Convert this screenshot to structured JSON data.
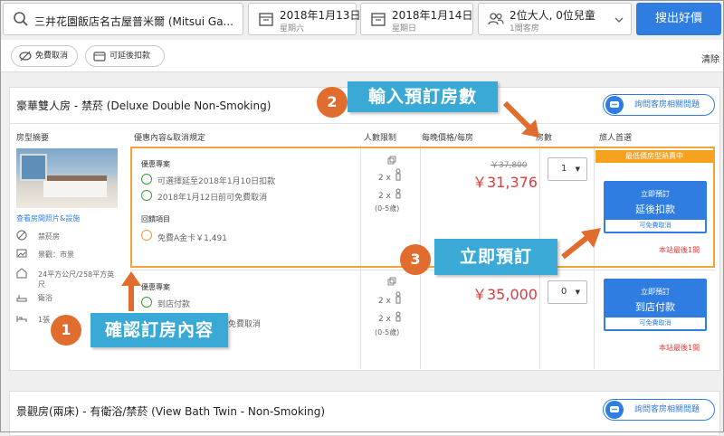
{
  "search": {
    "hotel": "三井花園飯店名古屋普米爾 (Mitsui Ga...",
    "checkin_date": "2018年1月13日",
    "checkin_day": "星期六",
    "checkout_date": "2018年1月14日",
    "checkout_day": "星期日",
    "guests": "2位大人, 0位兒童",
    "rooms": "1間客房",
    "button": "搜出好價"
  },
  "filters": {
    "free_cancel": "免費取消",
    "pay_later": "可延後扣款",
    "clear": "清除"
  },
  "room1": {
    "title": "豪華雙人房 - 禁菸 (Deluxe Double Non-Smoking)",
    "question_btn": "詢問客房相關問題",
    "headers": {
      "summary": "房型摘要",
      "offer": "優惠內容&取消規定",
      "occupancy": "人數限制",
      "price": "每晚價格/每房",
      "rooms": "房數",
      "choice": "旅人首選"
    },
    "photo_link": "查看房間照片&設施",
    "features": [
      "禁菸房",
      "景觀：市景",
      "24平方公尺/258平方英尺",
      "衛浴",
      "1張"
    ],
    "offer1": {
      "label": "優惠專案",
      "line1": "可選擇延至2018年1月10日扣款",
      "line2": "2018年1月12日前可免費取消",
      "bonus_label": "回饋項目",
      "bonus": "免費A金卡￥1,491",
      "occ_adult": "2 x",
      "occ_child": "2 x",
      "occ_child_note": "(0-5歲)",
      "price_old": "￥37,800",
      "price": "￥31,376",
      "qty": "1",
      "ribbon": "最低價房型熱賣中",
      "book_l1": "立即預訂",
      "book_l2": "延後扣款",
      "book_l3": "可免費取消",
      "remaining": "本站最後1間"
    },
    "offer2": {
      "label": "優惠專案",
      "line1": "到店付款",
      "line2": "免費取消",
      "occ_adult": "2 x",
      "occ_child": "2 x",
      "occ_child_note": "(0-5歲)",
      "price": "￥35,000",
      "qty": "0",
      "book_l1": "立即預訂",
      "book_l2": "到店付款",
      "book_l3": "可免費取消",
      "remaining": "本站最後1間"
    }
  },
  "room2": {
    "title": "景觀房(兩床) - 有衛浴/禁菸 (View Bath Twin - Non-Smoking)",
    "question_btn": "詢問客房相關問題"
  },
  "annotations": {
    "step1_num": "1",
    "step1": "確認訂房內容",
    "step2_num": "2",
    "step2": "輸入預訂房數",
    "step3_num": "3",
    "step3": "立即預訂"
  },
  "colors": {
    "primary": "#2f7de1",
    "accent_orange": "#e06c2e",
    "callout": "#3aa9d6",
    "price_red": "#e03b3b",
    "highlight_border": "#f0a43a"
  }
}
